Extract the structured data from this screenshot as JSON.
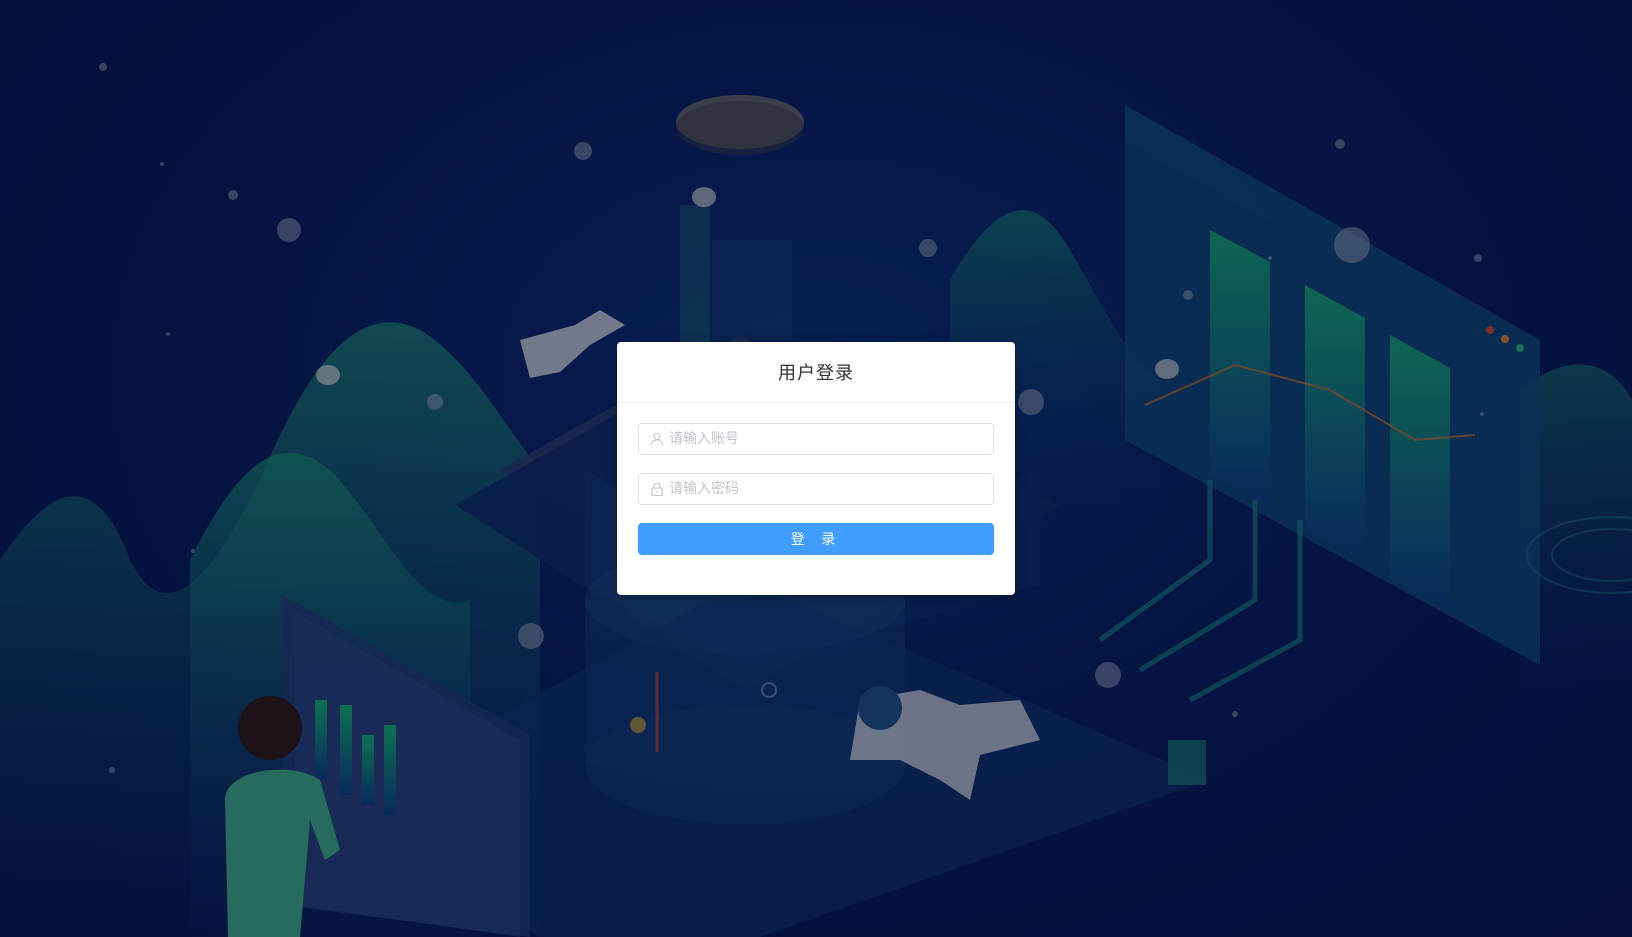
{
  "login": {
    "title": "用户登录",
    "username_placeholder": "请输入账号",
    "password_placeholder": "请输入密码",
    "submit_label": "登 录"
  },
  "icons": {
    "username": "user-icon",
    "password": "lock-icon"
  },
  "colors": {
    "background": "#071c52",
    "primary": "#409eff",
    "card": "#ffffff"
  }
}
